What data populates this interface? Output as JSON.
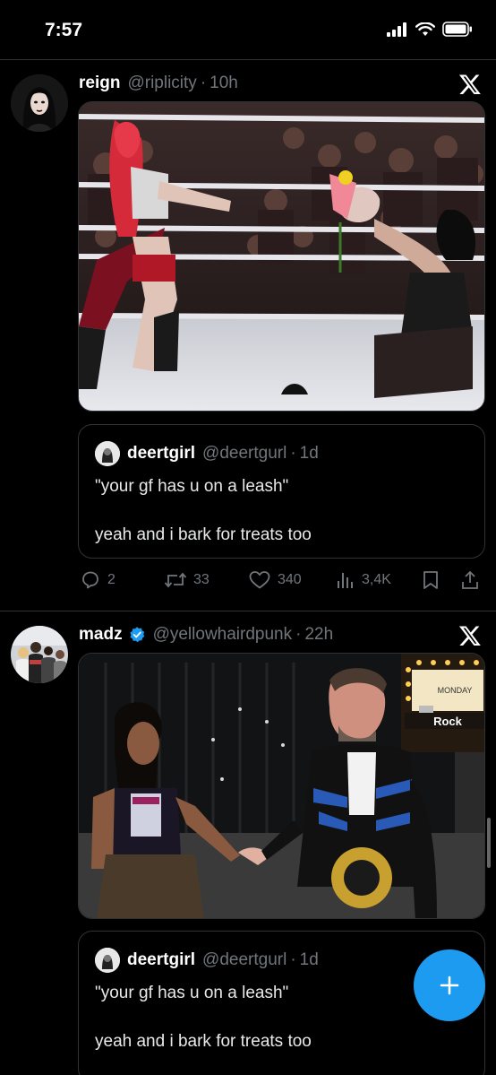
{
  "status_bar": {
    "time": "7:57"
  },
  "tweets": [
    {
      "display_name": "reign",
      "handle": "@riplicity",
      "time": "10h",
      "verified": false,
      "quote": {
        "display_name": "deertgirl",
        "handle": "@deertgurl",
        "time": "1d",
        "line1": "\"your gf has u on a leash\"",
        "line2": "yeah and i bark for treats too"
      },
      "stats": {
        "replies": "2",
        "reposts": "33",
        "likes": "340",
        "views": "3,4K"
      }
    },
    {
      "display_name": "madz",
      "handle": "@yellowhairdpunk",
      "time": "22h",
      "verified": true,
      "media_signs": {
        "sign1": "MONDAY",
        "sign2": "Rock"
      },
      "quote": {
        "display_name": "deertgirl",
        "handle": "@deertgurl",
        "time": "1d",
        "line1": "\"your gf has u on a leash\"",
        "line2": "yeah and i bark for treats too"
      }
    }
  ],
  "colors": {
    "accent": "#1d9bf0",
    "muted": "#71767b",
    "border": "#2f3336",
    "background": "#000000"
  },
  "icons": [
    "signal-icon",
    "wifi-icon",
    "battery-icon",
    "x-logo-icon",
    "reply-icon",
    "repost-icon",
    "like-icon",
    "views-icon",
    "bookmark-icon",
    "share-icon",
    "verified-icon",
    "plus-icon"
  ]
}
